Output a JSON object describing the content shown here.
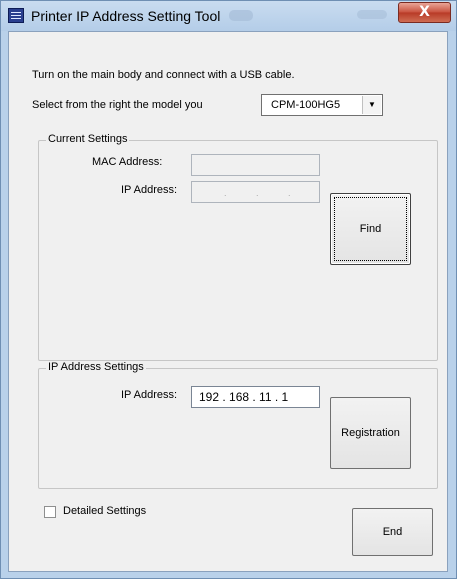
{
  "window": {
    "title": "Printer IP Address Setting Tool",
    "close_glyph": "X"
  },
  "intro": {
    "instruction": "Turn on the main body and connect with a USB cable.",
    "select_label": "Select from the right the model you",
    "model_value": "CPM-100HG5"
  },
  "current_settings": {
    "title": "Current Settings",
    "mac_label": "MAC Address:",
    "mac_value": "",
    "ip_label": "IP Address:",
    "ip_dots": [
      ".",
      ".",
      "."
    ],
    "find_label": "Find"
  },
  "ip_settings": {
    "title": "IP Address Settings",
    "ip_label": "IP Address:",
    "ip_value": "192 . 168 .  11  .   1",
    "register_label": "Registration"
  },
  "footer": {
    "detailed_label": "Detailed Settings",
    "detailed_checked": false,
    "end_label": "End"
  }
}
